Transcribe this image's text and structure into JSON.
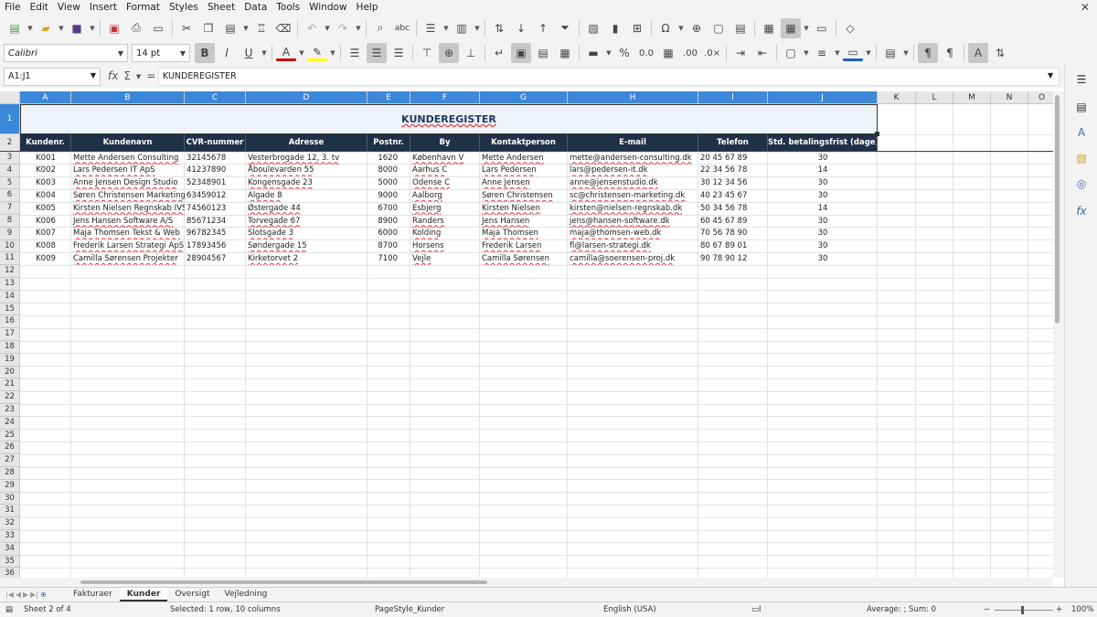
{
  "menu": [
    "File",
    "Edit",
    "View",
    "Insert",
    "Format",
    "Styles",
    "Sheet",
    "Data",
    "Tools",
    "Window",
    "Help"
  ],
  "font": {
    "name": "Calibri",
    "size": "14 pt"
  },
  "formula": {
    "cell_ref": "A1:J1",
    "content": "KUNDEREGISTER"
  },
  "columns": [
    {
      "letter": "A",
      "w": 56
    },
    {
      "letter": "B",
      "w": 124
    },
    {
      "letter": "C",
      "w": 67
    },
    {
      "letter": "D",
      "w": 133
    },
    {
      "letter": "E",
      "w": 47
    },
    {
      "letter": "F",
      "w": 76
    },
    {
      "letter": "G",
      "w": 96
    },
    {
      "letter": "H",
      "w": 143
    },
    {
      "letter": "I",
      "w": 76
    },
    {
      "letter": "J",
      "w": 120
    },
    {
      "letter": "K",
      "w": 42
    },
    {
      "letter": "L",
      "w": 41
    },
    {
      "letter": "M",
      "w": 41
    },
    {
      "letter": "N",
      "w": 41
    },
    {
      "letter": "O",
      "w": 30
    }
  ],
  "sheet_title": "KUNDEREGISTER",
  "headers": [
    "Kundenr.",
    "Kundenavn",
    "CVR-nummer",
    "Adresse",
    "Postnr.",
    "By",
    "Kontaktperson",
    "E-mail",
    "Telefon",
    "Std. betalingsfrist (dage)"
  ],
  "rows": [
    [
      "K001",
      "Mette Andersen Consulting",
      "32145678",
      "Vesterbrogade 12, 3. tv",
      "1620",
      "København V",
      "Mette Andersen",
      "mette@andersen-consulting.dk",
      "20 45 67 89",
      "30"
    ],
    [
      "K002",
      "Lars Pedersen IT ApS",
      "41237890",
      "Åboulevarden 55",
      "8000",
      "Aarhus C",
      "Lars Pedersen",
      "lars@pedersen-it.dk",
      "22 34 56 78",
      "14"
    ],
    [
      "K003",
      "Anne Jensen Design Studio",
      "52348901",
      "Kongensgade 23",
      "5000",
      "Odense C",
      "Anne Jensen",
      "anne@jensenstudio.dk",
      "30 12 34 56",
      "30"
    ],
    [
      "K004",
      "Søren Christensen Marketing",
      "63459012",
      "Algade 8",
      "9000",
      "Aalborg",
      "Søren Christensen",
      "sc@christensen-marketing.dk",
      "40 23 45 67",
      "30"
    ],
    [
      "K005",
      "Kirsten Nielsen Regnskab IVS",
      "74560123",
      "Østergade 44",
      "6700",
      "Esbjerg",
      "Kirsten Nielsen",
      "kirsten@nielsen-regnskab.dk",
      "50 34 56 78",
      "14"
    ],
    [
      "K006",
      "Jens Hansen Software A/S",
      "85671234",
      "Torvegade 67",
      "8900",
      "Randers",
      "Jens Hansen",
      "jens@hansen-software.dk",
      "60 45 67 89",
      "30"
    ],
    [
      "K007",
      "Maja Thomsen Tekst & Web",
      "96782345",
      "Slotsgade 3",
      "6000",
      "Kolding",
      "Maja Thomsen",
      "maja@thomsen-web.dk",
      "70 56 78 90",
      "30"
    ],
    [
      "K008",
      "Frederik Larsen Strategi ApS",
      "17893456",
      "Søndergade 15",
      "8700",
      "Horsens",
      "Frederik Larsen",
      "fl@larsen-strategi.dk",
      "80 67 89 01",
      "30"
    ],
    [
      "K009",
      "Camilla Sørensen Projekter",
      "28904567",
      "Kirketorvet 2",
      "7100",
      "Vejle",
      "Camilla Sørensen",
      "camilla@soerensen-proj.dk",
      "90 78 90 12",
      "30"
    ]
  ],
  "row_numbers_after": [
    "12",
    "13",
    "14",
    "15",
    "16",
    "17",
    "18",
    "19",
    "20",
    "21",
    "22",
    "23",
    "24",
    "25",
    "26",
    "27",
    "28",
    "29",
    "30",
    "31",
    "32",
    "33",
    "34",
    "35",
    "36"
  ],
  "tabs": [
    "Fakturaer",
    "Kunder",
    "Oversigt",
    "Vejledning"
  ],
  "active_tab": "Kunder",
  "status": {
    "sheet": "Sheet 2 of 4",
    "selection": "Selected: 1 row, 10 columns",
    "page_style": "PageStyle_Kunder",
    "language": "English (USA)",
    "sum": "Average: ; Sum: 0",
    "zoom": "100%"
  }
}
